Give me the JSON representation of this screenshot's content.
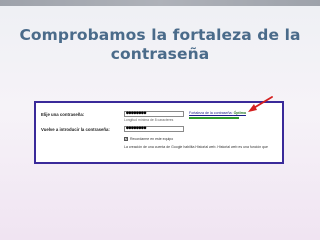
{
  "slide": {
    "title_line1": "Comprobamos la fortaleza de la",
    "title_line2": "contraseña"
  },
  "form": {
    "password_label": "Elije una contraseña:",
    "password_value": "●●●●●●●●",
    "password_hint": "Longitud mínima de 8 caracteres",
    "strength_label": "Fortaleza de la contraseña:",
    "strength_value": "Óptima",
    "strength_color": "#2e9a2e",
    "confirm_label": "Vuelve a introducir la contraseña:",
    "confirm_value": "●●●●●●●●",
    "remember_label": "Recordarme en este equipo",
    "remember_checked": true,
    "history_note": "La creación de una cuenta de Google habilita Historial web. Historial web es una función que"
  },
  "colors": {
    "title": "#4a6b8a",
    "card_border": "#3a2a9a",
    "arrow": "#d42020"
  }
}
